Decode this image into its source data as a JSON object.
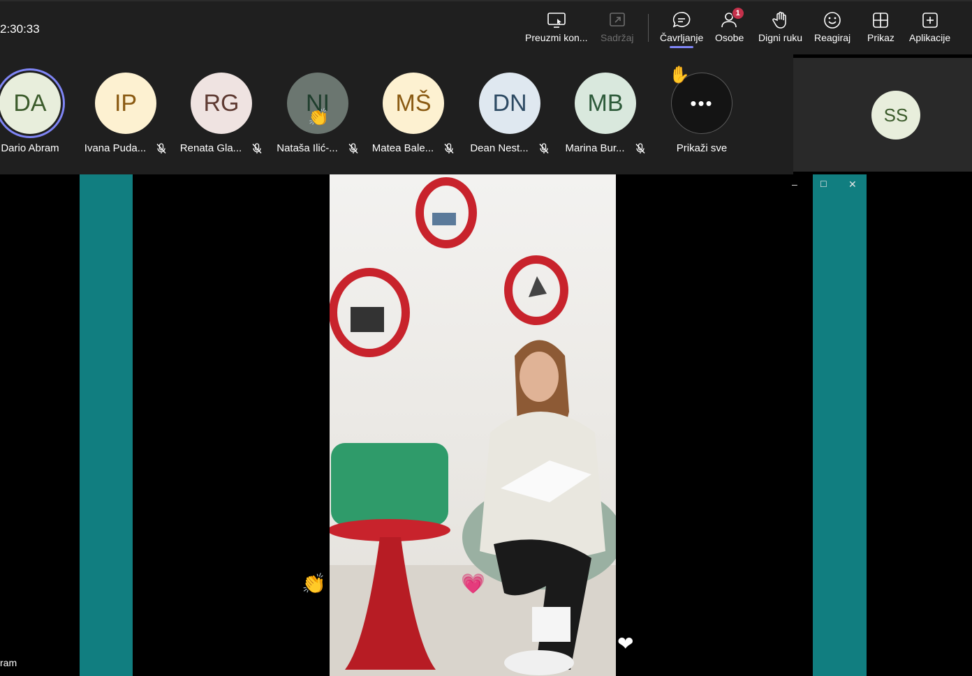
{
  "toolbar": {
    "timer": "2:30:33",
    "buttons": [
      {
        "label": "Preuzmi kon...",
        "icon": "share-screen-icon"
      },
      {
        "label": "Sadržaj",
        "icon": "content-icon"
      },
      {
        "label": "Čavrljanje",
        "icon": "chat-icon"
      },
      {
        "label": "Osobe",
        "icon": "people-icon",
        "badge": "1"
      },
      {
        "label": "Digni ruku",
        "icon": "raise-hand-icon"
      },
      {
        "label": "Reagiraj",
        "icon": "react-icon"
      },
      {
        "label": "Prikaz",
        "icon": "view-icon"
      },
      {
        "label": "Aplikacije",
        "icon": "apps-icon"
      }
    ]
  },
  "participants": [
    {
      "initials": "DA",
      "name": "Dario Abram",
      "bg": "#e8eedc",
      "fg": "#3b5b2b"
    },
    {
      "initials": "IP",
      "name": "Ivana Puda...",
      "bg": "#fdf1d1",
      "fg": "#8a5a12"
    },
    {
      "initials": "RG",
      "name": "Renata Gla...",
      "bg": "#efe3e1",
      "fg": "#5e3a32"
    },
    {
      "initials": "NI",
      "name": "Nataša Ilić-...",
      "bg": "#6b7670",
      "fg": "#1e3d2c"
    },
    {
      "initials": "MŠ",
      "name": "Matea Bale...",
      "bg": "#fdf1d1",
      "fg": "#8a5a12"
    },
    {
      "initials": "DN",
      "name": "Dean Nest...",
      "bg": "#dfe8f0",
      "fg": "#2d4a63"
    },
    {
      "initials": "MB",
      "name": "Marina Bur...",
      "bg": "#d9e8dd",
      "fg": "#2d5a3a"
    }
  ],
  "more": {
    "label": "Prikaži sve",
    "dots": "•••"
  },
  "self": {
    "initials": "SS",
    "bg": "#e8eedc",
    "fg": "#3b5b2b"
  },
  "stage": {
    "speaker_label": "ram",
    "window_controls": {
      "minimize": "–",
      "maximize": "☐",
      "close": "✕"
    }
  },
  "colors": {
    "accent": "#7f85f5",
    "teal": "#117e80",
    "badge": "#c4314b",
    "toolbar": "#1f1f1f"
  }
}
